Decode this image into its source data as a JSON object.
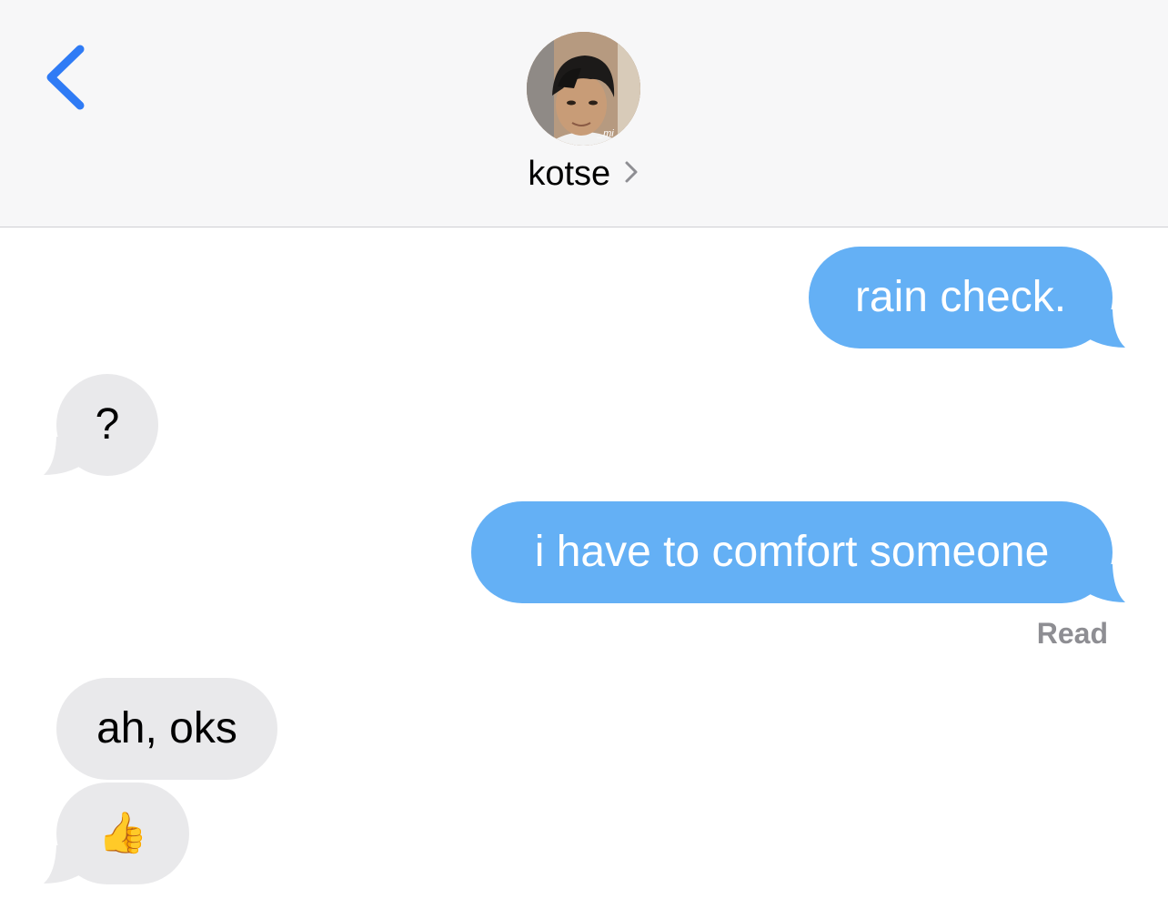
{
  "header": {
    "contact_name": "kotse",
    "avatar_watermark": "_mi",
    "back_icon": "chevron-left-icon",
    "contact_chevron_icon": "chevron-right-icon"
  },
  "messages": [
    {
      "direction": "sent",
      "text": "rain check."
    },
    {
      "direction": "received",
      "text": "?"
    },
    {
      "direction": "sent",
      "text": "i have to comfort someone"
    },
    {
      "direction": "received",
      "text": "ah, oks"
    },
    {
      "direction": "received",
      "text": "👍"
    }
  ],
  "read_receipt": "Read",
  "colors": {
    "sent_bubble": "#64b0f5",
    "received_bubble": "#e9e9eb",
    "accent": "#2f7bf5"
  }
}
